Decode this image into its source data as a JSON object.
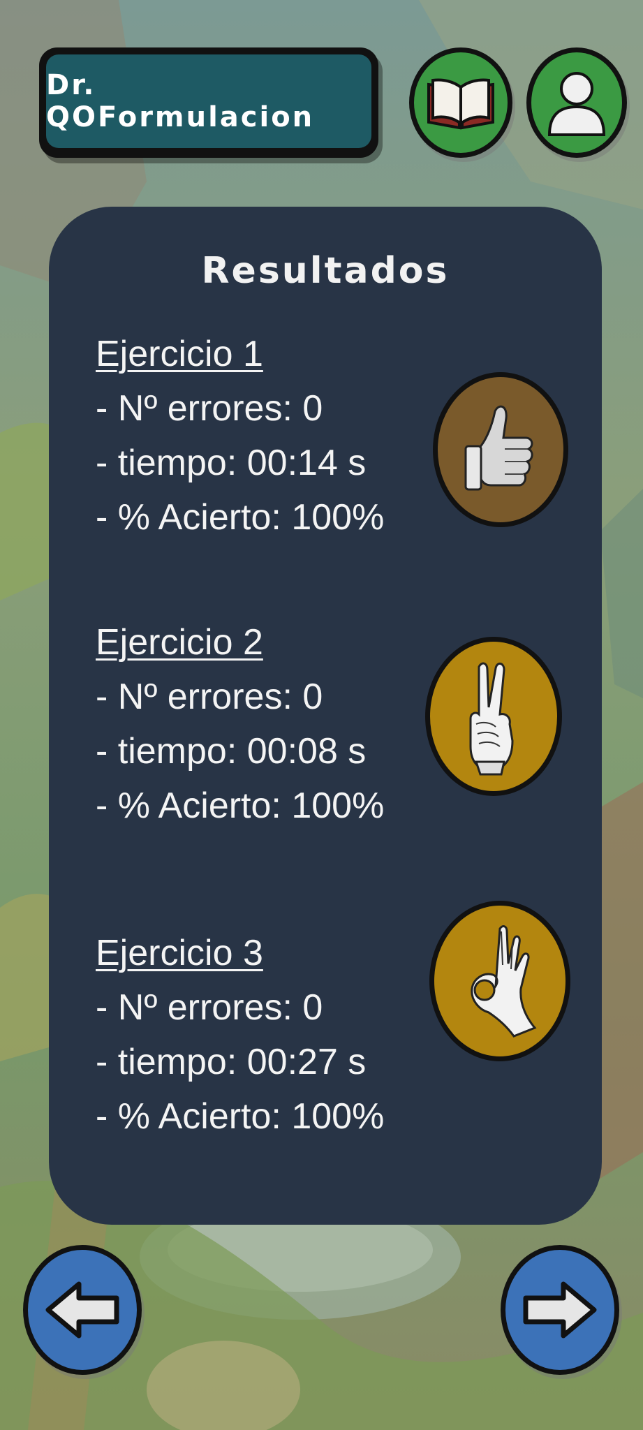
{
  "header": {
    "title": "Dr. QOFormulacion",
    "buttons": [
      {
        "name": "book-button",
        "icon": "book-icon",
        "color": "#3b9a43"
      },
      {
        "name": "profile-button",
        "icon": "user-icon",
        "color": "#3b9a43"
      }
    ]
  },
  "results": {
    "title": "Resultados",
    "exercises": [
      {
        "title": "Ejercicio 1",
        "errors": "- Nº errores: 0",
        "time": "- tiempo: 00:14 s",
        "accuracy": "- % Acierto: 100%",
        "medal": "thumbs-up-icon",
        "medal_color": "#7a5a2b"
      },
      {
        "title": "Ejercicio 2",
        "errors": "- Nº errores: 0",
        "time": "- tiempo: 00:08 s",
        "accuracy": "- % Acierto: 100%",
        "medal": "victory-hand-icon",
        "medal_color": "#b3860f"
      },
      {
        "title": "Ejercicio 3",
        "errors": "- Nº errores: 0",
        "time": "- tiempo: 00:27 s",
        "accuracy": "- % Acierto: 100%",
        "medal": "ok-hand-icon",
        "medal_color": "#b3860f"
      }
    ]
  },
  "navigation": {
    "back": {
      "icon": "arrow-left-icon",
      "color": "#3c72b8"
    },
    "next": {
      "icon": "arrow-right-icon",
      "color": "#3c72b8"
    }
  },
  "colors": {
    "panel": "#283446",
    "title_badge": "#1e5a64"
  }
}
